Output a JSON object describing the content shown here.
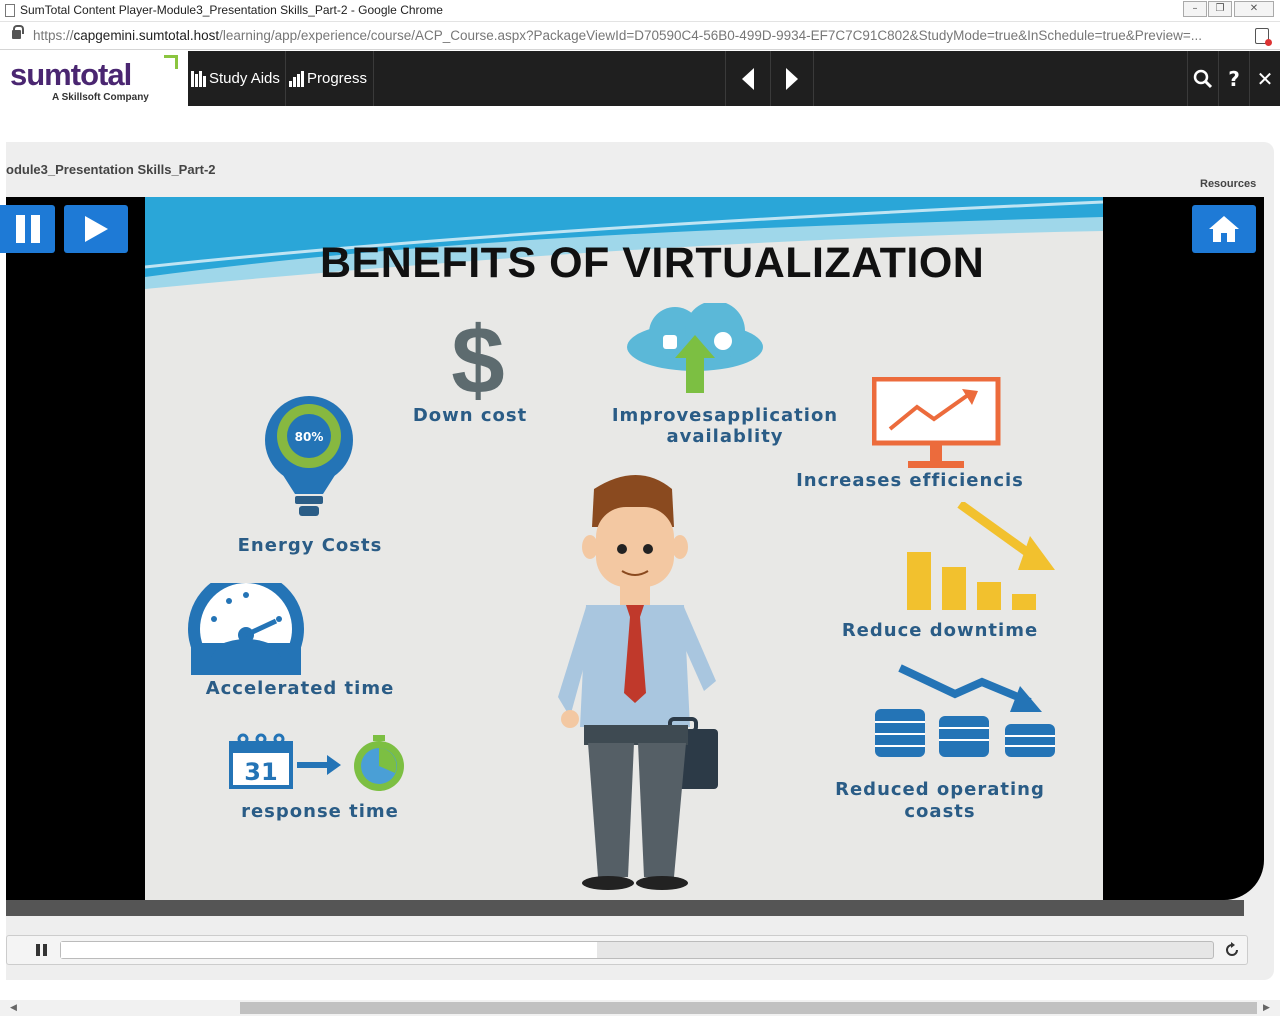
{
  "window": {
    "title": "SumTotal Content Player-Module3_Presentation Skills_Part-2 - Google Chrome"
  },
  "address_bar": {
    "scheme": "https://",
    "host": "capgemini.sumtotal.host",
    "path": "/learning/app/experience/course/ACP_Course.aspx?PackageViewId=D70590C4-56B0-499D-9934-EF7C7C91C802&StudyMode=true&InSchedule=true&Preview=..."
  },
  "app_header": {
    "logo_name": "sumtotal",
    "logo_tagline": "A Skillsoft Company",
    "study_aids_label": "Study Aids",
    "progress_label": "Progress",
    "icons": [
      "chevron-left-icon",
      "chevron-right-icon",
      "search-icon",
      "help-icon",
      "close-icon"
    ]
  },
  "player": {
    "module_title": "odule3_Presentation Skills_Part-2",
    "resources_label": "Resources",
    "seek_progress": 0.465,
    "accent_color": "#1e7ad6"
  },
  "slide": {
    "title": "BENEFITS OF VIRTUALIZATION",
    "labels": {
      "down_cost": "Down cost",
      "improves_app_line1": "Improvesapplication",
      "improves_app_line2": "availablity",
      "increases_eff": "Increases efficiencis",
      "energy_costs": "Energy Costs",
      "reduce_downtime": "Reduce downtime",
      "accelerated_time": "Accelerated time",
      "reduced_op_line1": "Reduced operating",
      "reduced_op_line2": "coasts",
      "response_time": "response time",
      "bulb_percent": "80%",
      "calendar_day": "31"
    }
  }
}
